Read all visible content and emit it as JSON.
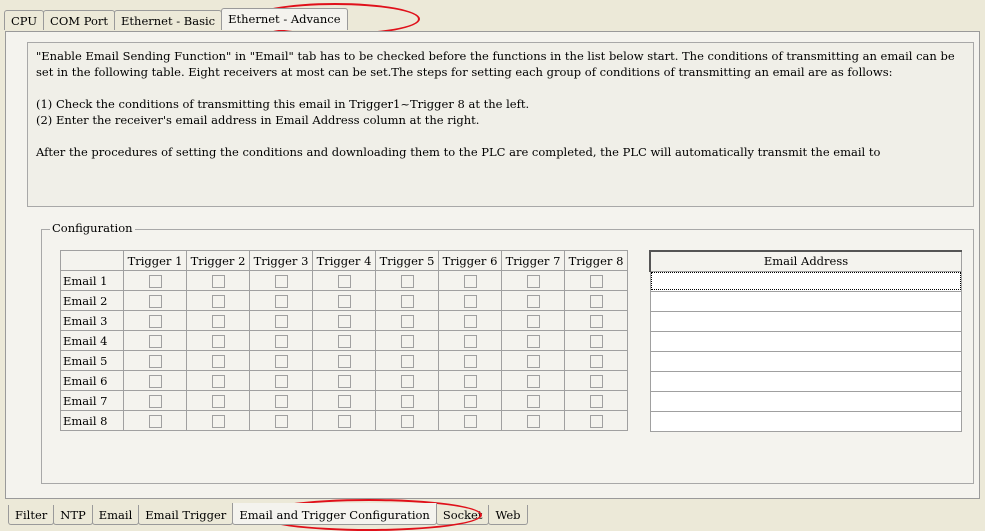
{
  "top_tabs": [
    "CPU",
    "COM Port",
    "Ethernet - Basic",
    "Ethernet - Advance"
  ],
  "info": {
    "para1": "\"Enable Email Sending Function\" in \"Email\" tab has to be checked before the functions in the list below start. The conditions of transmitting an email can be set in the following table. Eight receivers at most can be set.The steps for setting each group of conditions of transmitting an email are as follows:",
    "step1": "(1) Check the conditions of transmitting this email in Trigger1~Trigger 8 at the left.",
    "step2": "(2) Enter the receiver's email address in Email Address column at the right.",
    "para2": "After the procedures of setting the conditions and downloading them to the PLC are completed, the PLC will automatically transmit the email to"
  },
  "configuration": {
    "label": "Configuration",
    "trigger_headers": [
      "Trigger 1",
      "Trigger 2",
      "Trigger 3",
      "Trigger 4",
      "Trigger 5",
      "Trigger 6",
      "Trigger 7",
      "Trigger 8"
    ],
    "rows": [
      "Email 1",
      "Email 2",
      "Email 3",
      "Email 4",
      "Email 5",
      "Email 6",
      "Email 7",
      "Email 8"
    ],
    "email_header": "Email Address",
    "email_values": [
      "",
      "",
      "",
      "",
      "",
      "",
      "",
      ""
    ]
  },
  "bottom_tabs": [
    "Filter",
    "NTP",
    "Email",
    "Email Trigger",
    "Email and Trigger Configuration",
    "Socket",
    "Web"
  ],
  "colors": {
    "highlight": "#e0101a",
    "panel": "#f4f3ee",
    "background": "#ece9d8"
  }
}
